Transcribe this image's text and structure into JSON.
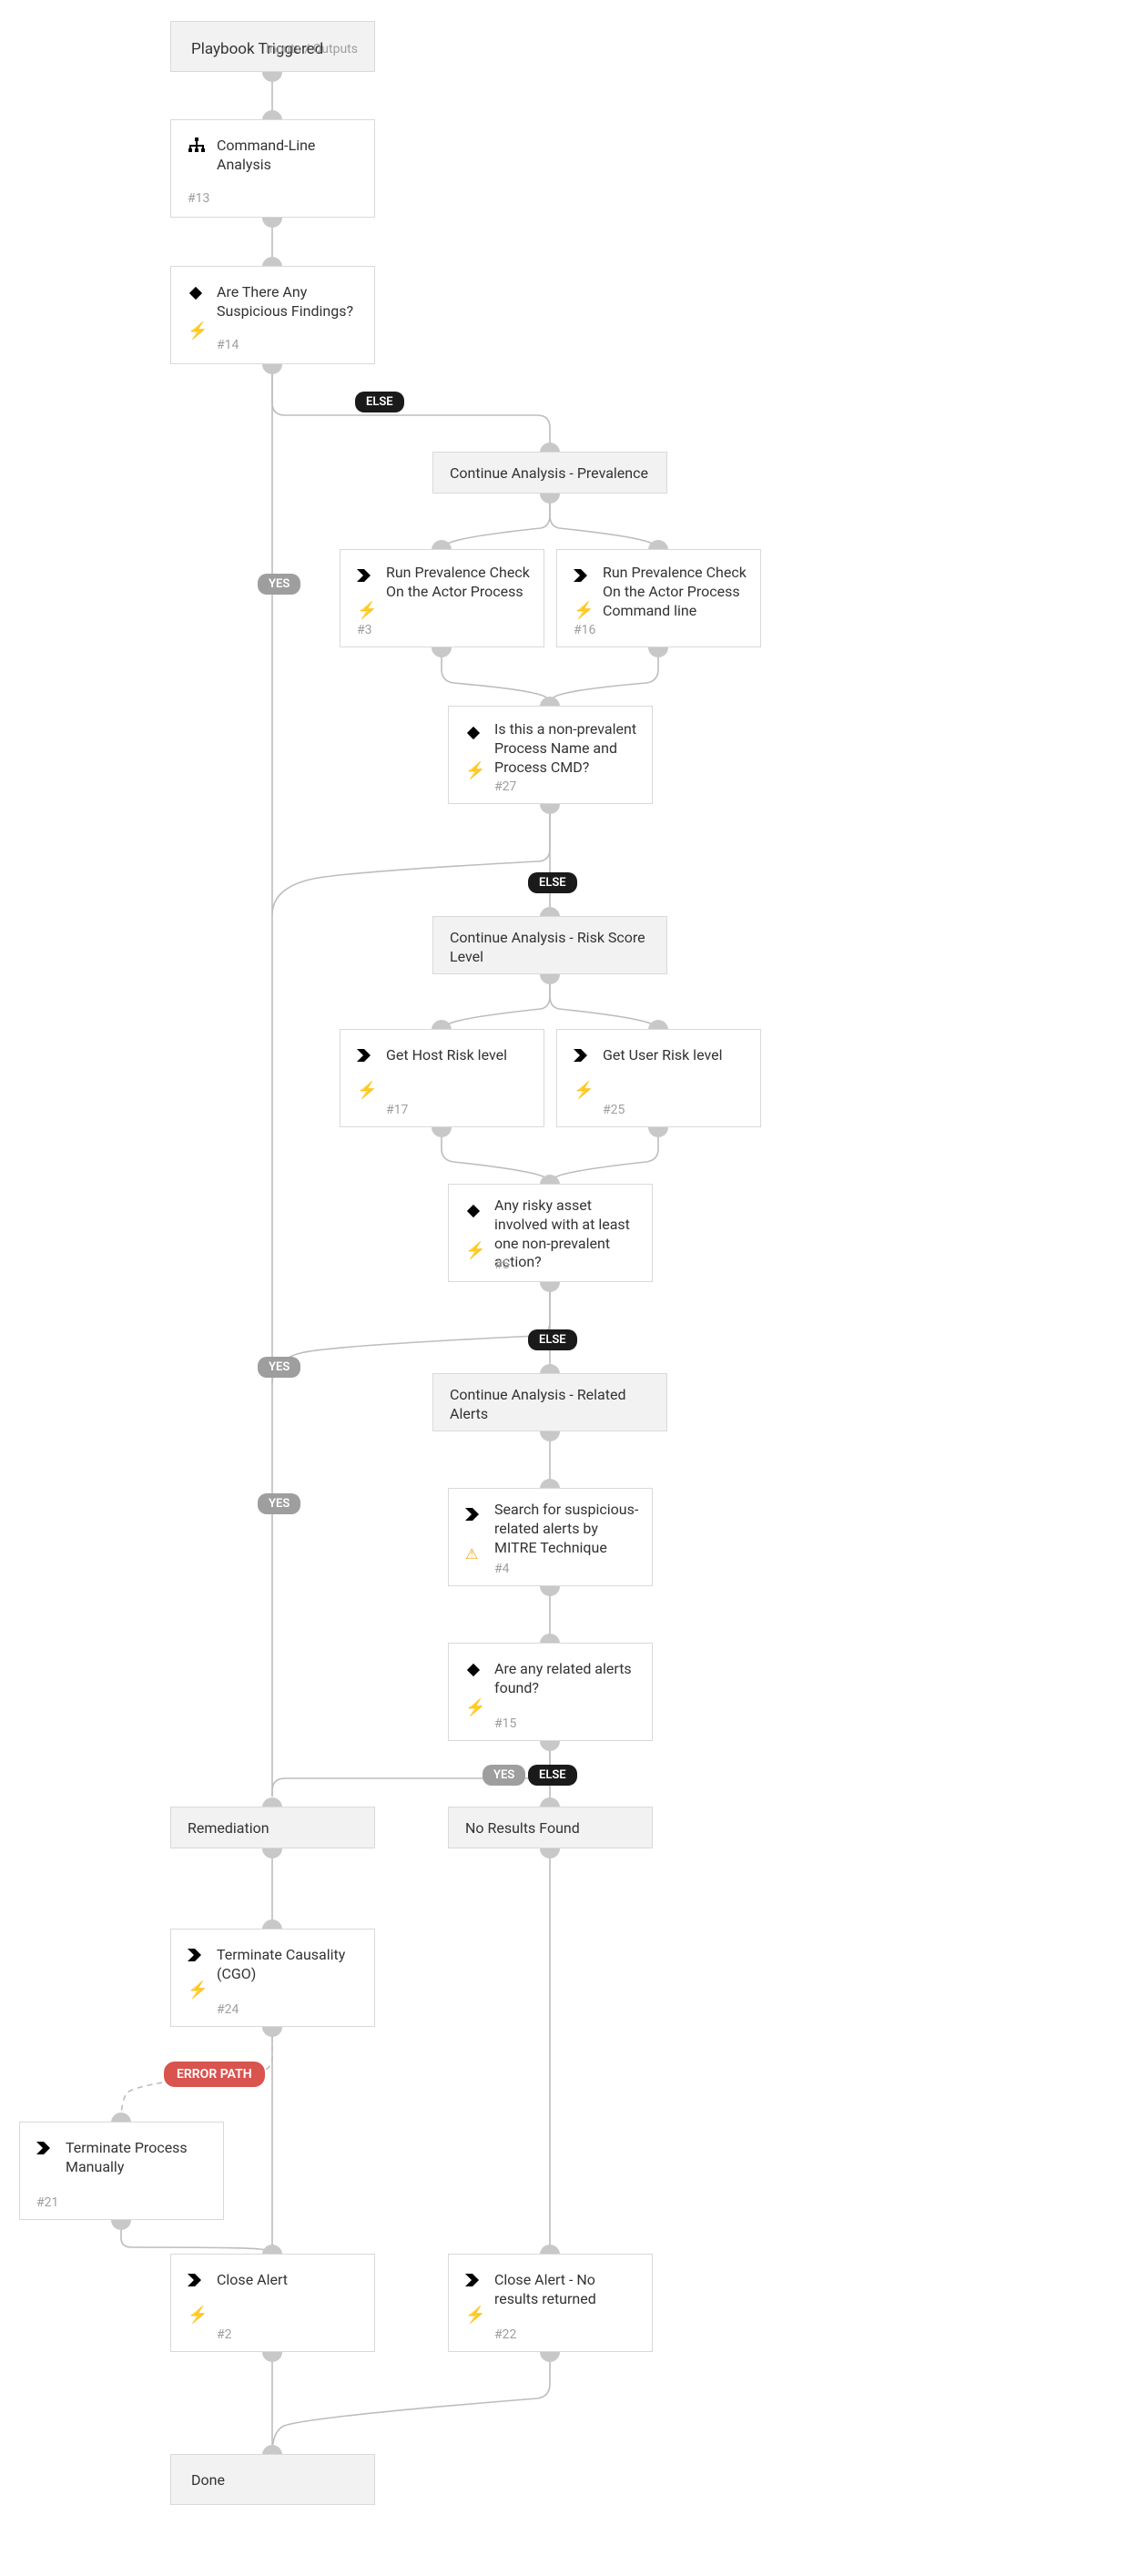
{
  "labels": {
    "yes": "YES",
    "else": "ELSE",
    "error_path": "ERROR PATH"
  },
  "trigger": {
    "title": "Playbook Triggered",
    "io": "Inputs / Outputs"
  },
  "nodes": {
    "n13": {
      "title": "Command-Line Analysis",
      "id": "#13"
    },
    "n14": {
      "title": "Are There Any Suspicious Findings?",
      "id": "#14"
    },
    "sec_prevalence": {
      "title": "Continue Analysis - Prevalence"
    },
    "n3": {
      "title": "Run Prevalence Check On the Actor Process",
      "id": "#3"
    },
    "n16": {
      "title": "Run Prevalence Check On the Actor Process Command line",
      "id": "#16"
    },
    "n27": {
      "title": "Is this a non-prevalent Process Name and Process CMD?",
      "id": "#27"
    },
    "sec_risk": {
      "title": "Continue Analysis - Risk Score Level"
    },
    "n17": {
      "title": "Get Host Risk level",
      "id": "#17"
    },
    "n25": {
      "title": "Get User Risk level",
      "id": "#25"
    },
    "n5": {
      "title": "Any risky asset involved with at least one non-prevalent action?",
      "id": "#5"
    },
    "sec_related": {
      "title": "Continue Analysis - Related Alerts"
    },
    "n4": {
      "title": "Search for suspicious-related alerts by MITRE Technique",
      "id": "#4"
    },
    "n15": {
      "title": "Are any related alerts found?",
      "id": "#15"
    },
    "sec_remediation": {
      "title": "Remediation"
    },
    "sec_noresults": {
      "title": "No Results Found"
    },
    "n24": {
      "title": "Terminate Causality (CGO)",
      "id": "#24"
    },
    "n21": {
      "title": "Terminate Process Manually",
      "id": "#21"
    },
    "n2": {
      "title": "Close Alert",
      "id": "#2"
    },
    "n22": {
      "title": "Close Alert - No results returned",
      "id": "#22"
    },
    "done": {
      "title": "Done"
    }
  }
}
